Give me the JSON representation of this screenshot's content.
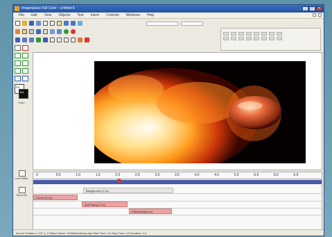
{
  "window": {
    "title": "ImageSpace Full Color - Untitled 8"
  },
  "menubar": {
    "items": [
      "File",
      "Edit",
      "View",
      "Objects",
      "Text",
      "Insert",
      "Controls",
      "Windows",
      "Help"
    ]
  },
  "toolbar": {
    "field1": "",
    "field2": ""
  },
  "props_panel": {
    "title": ""
  },
  "tools": {
    "color_label": "Color",
    "line_label": "Line Width",
    "show_label": "Show All"
  },
  "timeline": {
    "ticks": [
      "0",
      "0.5",
      "1.0",
      "1.5",
      "2.0",
      "2.5",
      "3.0",
      "3.5",
      "4.0",
      "4.5",
      "5.0",
      "5.5",
      "6.0",
      "6.5"
    ],
    "tracks": [
      {
        "label": "Background (1.1s)",
        "color": "#e8e8e8"
      },
      {
        "label": "Comet (0.1s)",
        "color": "#e9a0a0"
      },
      {
        "label": "Bolt Flying (1.1s)",
        "color": "#e9a0a0"
      },
      {
        "label": "Path/Rotation (s)",
        "color": "#e9a0a0"
      }
    ]
  },
  "status": {
    "text": "Mouse Position x: 107 y: 2      Object Name: PathBall-bitmap.wbp   Start Time: 3.0   Stop Time: 4.0   Duration: 1.0"
  },
  "colors": {
    "accent": "#2453a3",
    "timeline_bar": "#4a5aa8",
    "cursor": "#dd3333"
  }
}
